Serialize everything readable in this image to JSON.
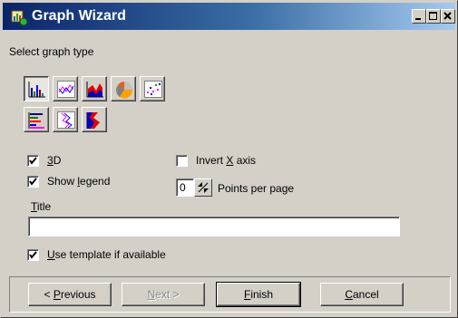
{
  "window": {
    "title": "Graph Wizard"
  },
  "titlebar_buttons": [
    "minimize-icon",
    "maximize-icon",
    "close-icon"
  ],
  "section_label": "Select graph type",
  "graph_types_row1": [
    "bar",
    "line",
    "area",
    "pie",
    "scatter"
  ],
  "graph_types_row2": [
    "horizontal-bar",
    "vertical-line",
    "vertical-area"
  ],
  "options": {
    "three_d": {
      "pre": "",
      "access": "3",
      "post": "D",
      "checked": true
    },
    "show_legend": {
      "pre": "Show ",
      "access": "l",
      "post": "egend",
      "checked": true
    },
    "invert_x": {
      "pre": "Invert ",
      "access": "X",
      "post": " axis",
      "checked": false
    },
    "use_template": {
      "pre": "",
      "access": "U",
      "post": "se template if available",
      "checked": true
    }
  },
  "points_per_page": {
    "value": "0",
    "label": "Points per page"
  },
  "title_field": {
    "label_access": "T",
    "label_rest": "itle",
    "value": ""
  },
  "buttons": {
    "previous": {
      "pre": "< ",
      "access": "P",
      "post": "revious"
    },
    "next": {
      "pre": "",
      "access": "N",
      "post": "ext >"
    },
    "finish": {
      "pre": "",
      "access": "F",
      "post": "inish"
    },
    "cancel": {
      "pre": "",
      "access": "C",
      "post": "ancel"
    }
  },
  "colors": {
    "titlebar_start": "#0a246a",
    "titlebar_end": "#a6caf0",
    "face": "#d4d0c8"
  }
}
